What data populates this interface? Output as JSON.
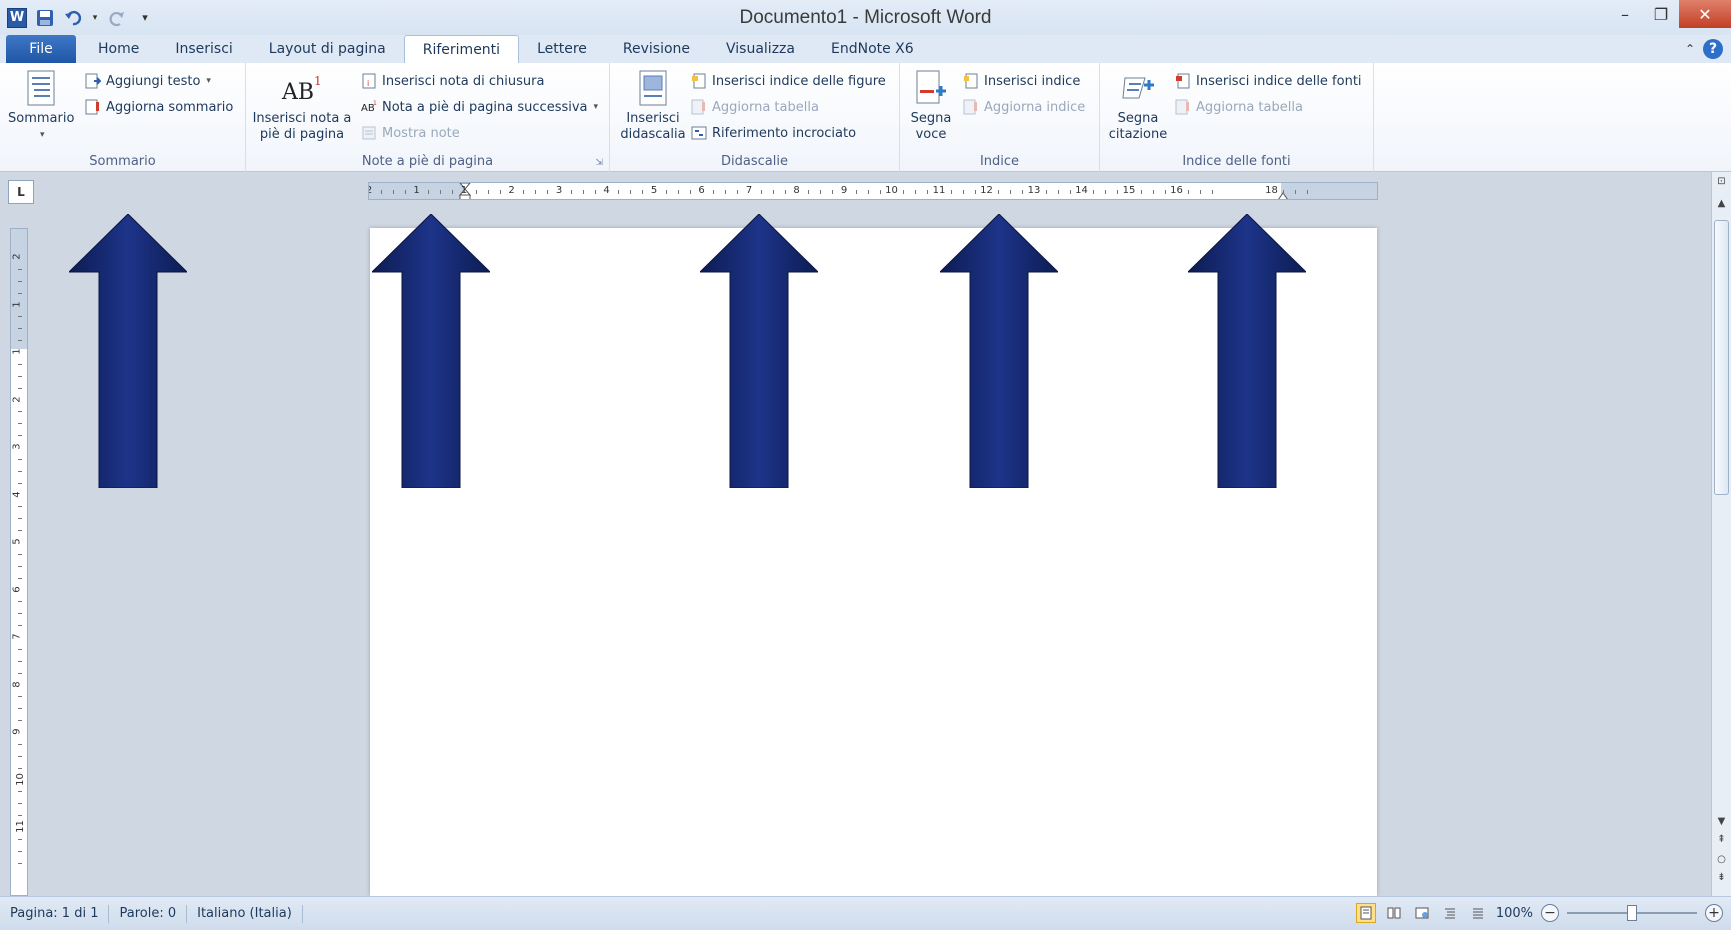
{
  "window": {
    "title": "Documento1  -  Microsoft Word",
    "app_icon": "W"
  },
  "tabs": [
    {
      "label": "File",
      "name": "tab-file"
    },
    {
      "label": "Home",
      "name": "tab-home"
    },
    {
      "label": "Inserisci",
      "name": "tab-inserisci"
    },
    {
      "label": "Layout di pagina",
      "name": "tab-layout"
    },
    {
      "label": "Riferimenti",
      "name": "tab-riferimenti",
      "active": true
    },
    {
      "label": "Lettere",
      "name": "tab-lettere"
    },
    {
      "label": "Revisione",
      "name": "tab-revisione"
    },
    {
      "label": "Visualizza",
      "name": "tab-visualizza"
    },
    {
      "label": "EndNote X6",
      "name": "tab-endnote"
    }
  ],
  "ribbon": {
    "sommario": {
      "group_label": "Sommario",
      "sommario_btn": "Sommario",
      "aggiungi_testo": "Aggiungi testo",
      "aggiorna_sommario": "Aggiorna sommario"
    },
    "note": {
      "group_label": "Note a piè di pagina",
      "inserisci_nota_line1": "Inserisci nota a",
      "inserisci_nota_line2": "piè di pagina",
      "inserisci_nota_chiusura": "Inserisci nota di chiusura",
      "nota_successiva": "Nota a piè di pagina successiva",
      "mostra_note": "Mostra note"
    },
    "didascalie": {
      "group_label": "Didascalie",
      "inserisci_line1": "Inserisci",
      "inserisci_line2": "didascalia",
      "indice_figure": "Inserisci indice delle figure",
      "aggiorna_tabella": "Aggiorna tabella",
      "riferimento_incrociato": "Riferimento incrociato"
    },
    "indice": {
      "group_label": "Indice",
      "segna_line1": "Segna",
      "segna_line2": "voce",
      "inserisci_indice": "Inserisci indice",
      "aggiorna_indice": "Aggiorna indice"
    },
    "fonti": {
      "group_label": "Indice delle fonti",
      "segna_line1": "Segna",
      "segna_line2": "citazione",
      "inserisci_indice_fonti": "Inserisci indice delle fonti",
      "aggiorna_tabella": "Aggiorna tabella"
    }
  },
  "ruler": {
    "ruler_corner": "L",
    "h_ticks": [
      "2",
      "1",
      "1",
      "2",
      "3",
      "4",
      "5",
      "6",
      "7",
      "8",
      "9",
      "10",
      "11",
      "12",
      "13",
      "14",
      "15",
      "16",
      "18"
    ],
    "v_ticks": [
      "2",
      "1",
      "1",
      "2",
      "3",
      "4",
      "5",
      "6",
      "7",
      "8",
      "9",
      "10",
      "11"
    ]
  },
  "status": {
    "pagina": "Pagina: 1 di 1",
    "parole": "Parole: 0",
    "lingua": "Italiano (Italia)",
    "zoom": "100%",
    "zoom_level": 0.5
  },
  "colors": {
    "arrow": "#14266a",
    "ribbon_accent": "#2a5aa8"
  }
}
